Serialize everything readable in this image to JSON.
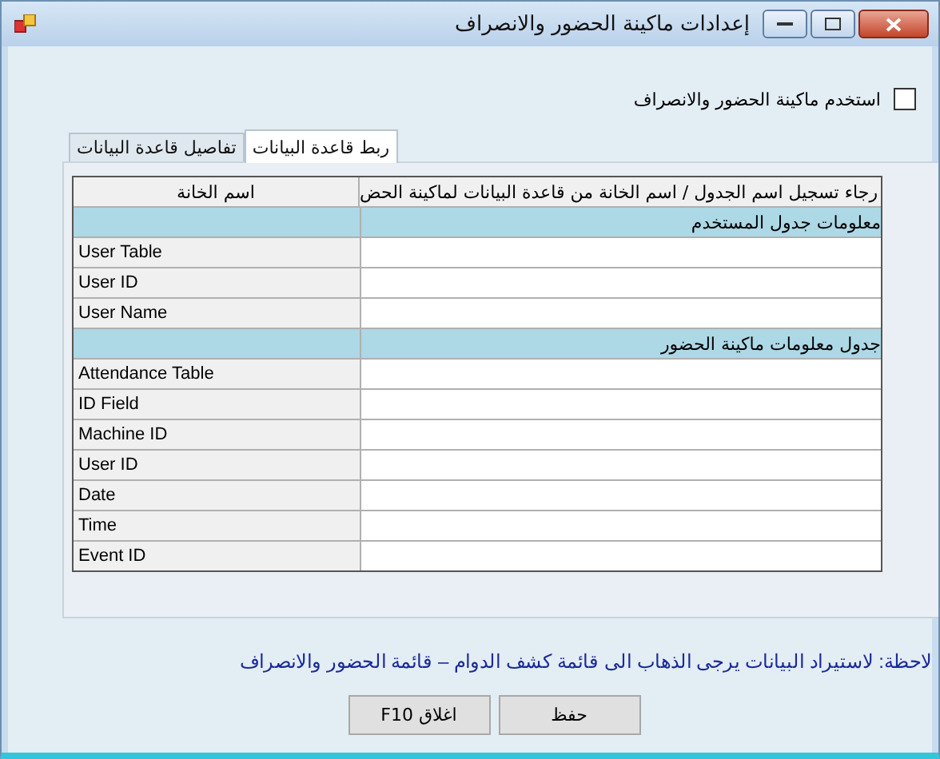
{
  "window": {
    "title": "إعدادات ماكينة الحضور والانصراف"
  },
  "use_machine": {
    "label": "استخدم ماكينة الحضور والانصراف",
    "checked": false
  },
  "tabs": [
    {
      "label": "ربط قاعدة البيانات",
      "selected": true
    },
    {
      "label": "تفاصيل قاعدة البيانات",
      "selected": false
    }
  ],
  "grid": {
    "columns": [
      "رجاء تسجيل اسم الجدول / اسم الخانة من قاعدة البيانات لماكينة الحض",
      "اسم الخانة"
    ],
    "rows": [
      {
        "kind": "section",
        "label": "معلومات جدول المستخدم"
      },
      {
        "kind": "field",
        "name": "User Table"
      },
      {
        "kind": "field",
        "name": "User ID"
      },
      {
        "kind": "field",
        "name": "User Name"
      },
      {
        "kind": "section",
        "label": "جدول معلومات ماكينة الحضور"
      },
      {
        "kind": "field",
        "name": "Attendance Table"
      },
      {
        "kind": "field",
        "name": "ID Field"
      },
      {
        "kind": "field",
        "name": "Machine ID"
      },
      {
        "kind": "field",
        "name": "User ID"
      },
      {
        "kind": "field",
        "name": "Date"
      },
      {
        "kind": "field",
        "name": "Time"
      },
      {
        "kind": "field",
        "name": "Event ID"
      }
    ]
  },
  "note": "لاحظة: لاستيراد البيانات يرجى الذهاب الى قائمة كشف الدوام – قائمة الحضور والانصراف",
  "buttons": [
    "حفظ",
    "اغلاق F10"
  ]
}
